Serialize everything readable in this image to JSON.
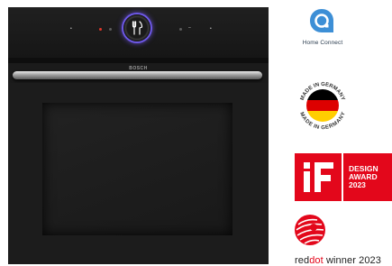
{
  "oven": {
    "brand": "BOSCH",
    "dial_icon": "cutlery-icon",
    "touch_left": "•",
    "touch_right": "•",
    "minus_label": "–",
    "colors": {
      "body": "#1b1b1b",
      "dial_ring": "#6d58e6",
      "led": "#e2372a"
    }
  },
  "badges": {
    "home_connect": {
      "icon": "home-connect-icon",
      "label": "Home Connect",
      "color": "#2c3e50"
    },
    "made_in_germany": {
      "top_text": "MADE IN GERMANY",
      "bottom_text": "MADE IN GERMANY",
      "flag_colors": [
        "#000000",
        "#dd0000",
        "#ffce00"
      ]
    },
    "if_award": {
      "logo_text": "iF",
      "lines": [
        "DESIGN",
        "AWARD",
        "2023"
      ],
      "color": "#e3071b"
    },
    "red_dot": {
      "word_red": "red",
      "word_dot": "dot",
      "suffix": " winner 2023",
      "icon": "red-dot-icon",
      "color": "#e3071b"
    }
  }
}
